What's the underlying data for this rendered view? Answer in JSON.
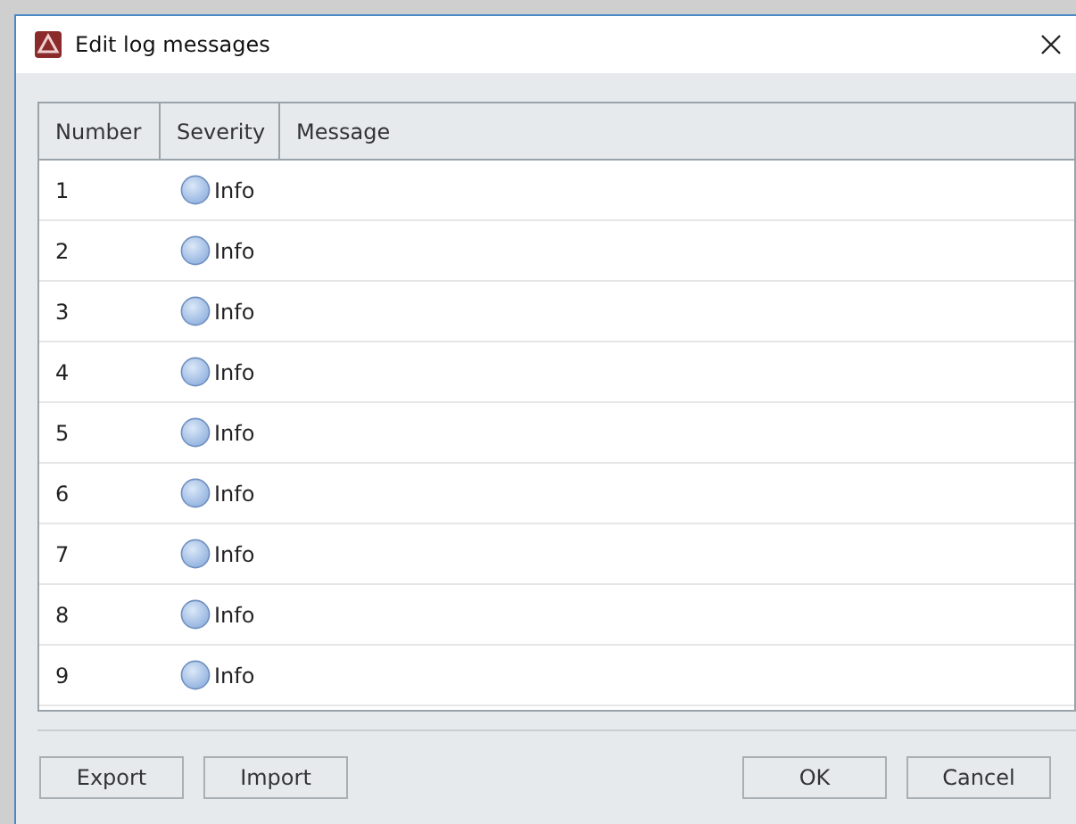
{
  "window": {
    "title": "Edit log messages"
  },
  "table": {
    "columns": [
      "Number",
      "Severity",
      "Message"
    ],
    "rows": [
      {
        "number": "1",
        "severity": "Info",
        "message": ""
      },
      {
        "number": "2",
        "severity": "Info",
        "message": ""
      },
      {
        "number": "3",
        "severity": "Info",
        "message": ""
      },
      {
        "number": "4",
        "severity": "Info",
        "message": ""
      },
      {
        "number": "5",
        "severity": "Info",
        "message": ""
      },
      {
        "number": "6",
        "severity": "Info",
        "message": ""
      },
      {
        "number": "7",
        "severity": "Info",
        "message": ""
      },
      {
        "number": "8",
        "severity": "Info",
        "message": ""
      },
      {
        "number": "9",
        "severity": "Info",
        "message": ""
      }
    ]
  },
  "buttons_left": [
    "Export",
    "Import"
  ],
  "buttons_right": [
    "OK",
    "Cancel"
  ]
}
